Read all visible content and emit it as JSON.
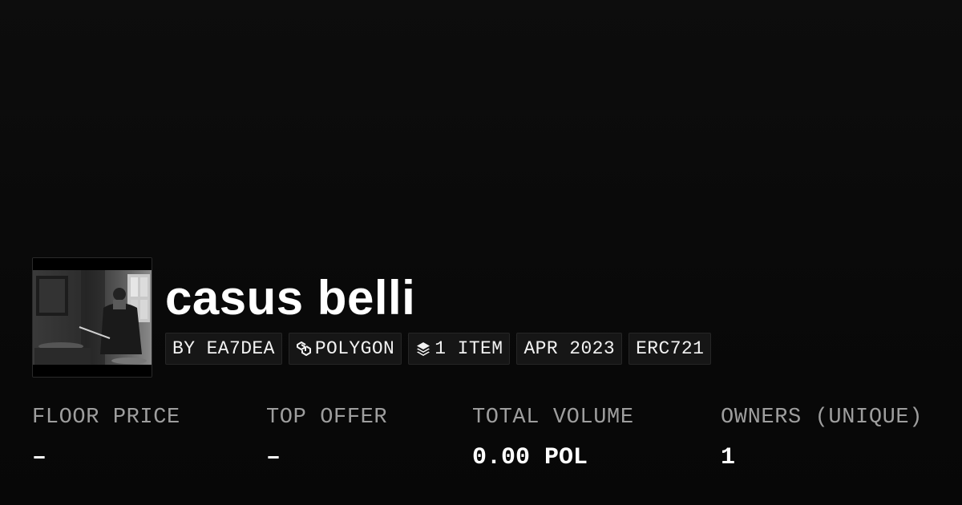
{
  "collection": {
    "name": "casus belli",
    "image": "collection-thumbnail-drummer"
  },
  "tags": [
    {
      "label": "BY EA7DEA",
      "icon": ""
    },
    {
      "label": "POLYGON",
      "icon": "polygon-chain-icon"
    },
    {
      "label": "1 ITEM",
      "icon": "layers-icon"
    },
    {
      "label": "APR 2023",
      "icon": ""
    },
    {
      "label": "ERC721",
      "icon": ""
    }
  ],
  "stats": [
    {
      "label": "FLOOR PRICE",
      "value": "–"
    },
    {
      "label": "TOP OFFER",
      "value": "–"
    },
    {
      "label": "TOTAL VOLUME",
      "value": "0.00 POL"
    },
    {
      "label": "OWNERS (UNIQUE)",
      "value": "1"
    }
  ],
  "colors": {
    "background": "#0a0a0a",
    "tag_background": "#161616",
    "label_gray": "#9e9e9e",
    "text": "#ffffff"
  }
}
